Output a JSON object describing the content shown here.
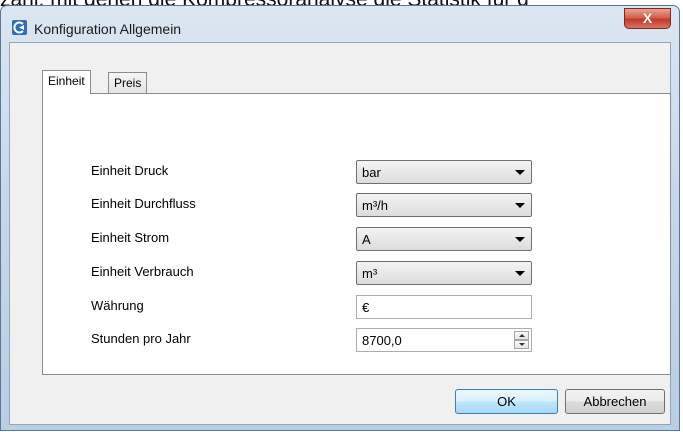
{
  "background_text": "zahl, mit denen die Kompressoranalyse die Statistik für d",
  "window": {
    "title": "Konfiguration Allgemein",
    "icon": "app-logo-icon",
    "close_label": "X"
  },
  "tabs": [
    {
      "label": "Einheit",
      "active": true
    },
    {
      "label": "Preis",
      "active": false
    }
  ],
  "form": {
    "pressure_label": "Einheit Druck",
    "pressure_value": "bar",
    "flow_label": "Einheit Durchfluss",
    "flow_value": "m³/h",
    "current_label": "Einheit Strom",
    "current_value": "A",
    "consumption_label": "Einheit Verbrauch",
    "consumption_value": "m³",
    "currency_label": "Währung",
    "currency_value": "€",
    "hours_label": "Stunden pro Jahr",
    "hours_value": "8700,0"
  },
  "buttons": {
    "ok_label": "OK",
    "cancel_label": "Abbrechen"
  },
  "colors": {
    "title_bar": "#c9d9ea",
    "close_button": "#c0392b",
    "ok_button_border": "#3c7fb1"
  }
}
